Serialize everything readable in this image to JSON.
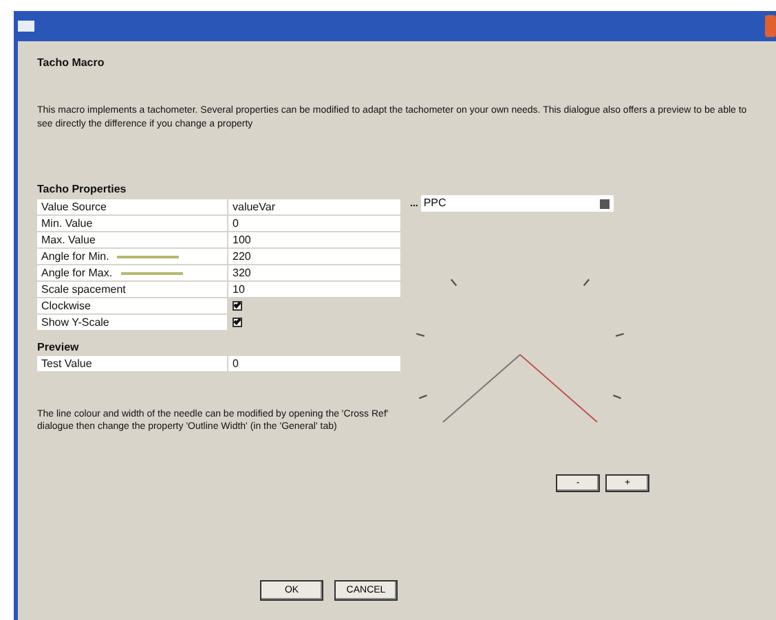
{
  "heading": "Tacho Macro",
  "description": "This macro implements a tachometer. Several properties can be modified to adapt the tachometer on your own needs. This dialogue also offers a preview to be able to see directly the difference if you change a property",
  "properties": {
    "title": "Tacho Properties",
    "rows": [
      {
        "kind": "text",
        "label": "Value Source",
        "value": "valueVar"
      },
      {
        "kind": "text",
        "label": "Min. Value",
        "value": "0"
      },
      {
        "kind": "text",
        "label": "Max. Value",
        "value": "100"
      },
      {
        "kind": "angle",
        "label": "Angle for Min.",
        "value": "220"
      },
      {
        "kind": "angle",
        "label": "Angle for Max.",
        "value": "320"
      },
      {
        "kind": "text",
        "label": "Scale spacement",
        "value": "10"
      },
      {
        "kind": "check",
        "label": "Clockwise",
        "checked": true
      },
      {
        "kind": "check",
        "label": "Show Y-Scale",
        "checked": true
      }
    ]
  },
  "source_picker": {
    "browse": "...",
    "value": "PPC"
  },
  "preview": {
    "title": "Preview",
    "label": "Test Value",
    "value": "0"
  },
  "note": "The line colour and width of the needle can be modified by opening the 'Cross Ref' dialogue then change the property 'Outline Width' (in the 'General' tab)",
  "step_buttons": [
    "-",
    "+"
  ],
  "buttons": [
    "OK",
    "CANCEL"
  ]
}
